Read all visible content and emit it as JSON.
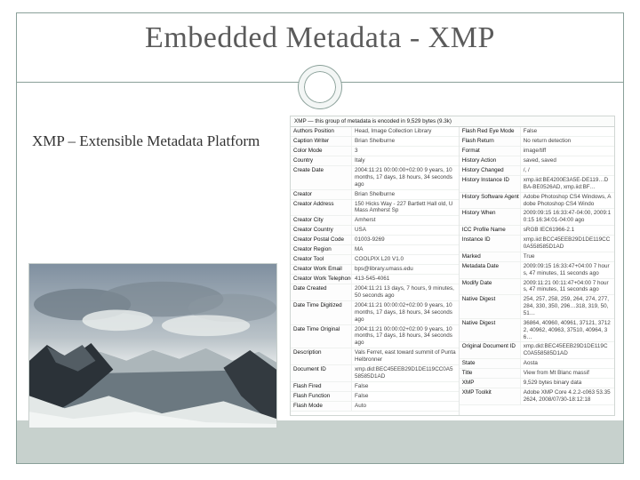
{
  "title": "Embedded Metadata - XMP",
  "subtitle": "XMP – Extensible Metadata Platform",
  "meta_header": "XMP — this group of metadata is encoded in 9,529 bytes (9.3k)",
  "left_rows": [
    {
      "k": "Authors Position",
      "v": "Head, Image Collection Library"
    },
    {
      "k": "Caption Writer",
      "v": "Brian Shelburne"
    },
    {
      "k": "Color Mode",
      "v": "3"
    },
    {
      "k": "Country",
      "v": "Italy"
    },
    {
      "k": "Create Date",
      "v": "2004:11:21 00:00:00+02:00\n9 years, 10 months, 17 days, 18 hours, 34 seconds ago"
    },
    {
      "k": "Creator",
      "v": "Brian Shelburne"
    },
    {
      "k": "Creator Address",
      "v": "150 Hicks Way - 227 Bartlett Hall old, UMass Amherst Sp"
    },
    {
      "k": "Creator City",
      "v": "Amherst"
    },
    {
      "k": "Creator Country",
      "v": "USA"
    },
    {
      "k": "Creator Postal Code",
      "v": "01003-9269"
    },
    {
      "k": "Creator Region",
      "v": "MA"
    },
    {
      "k": "Creator Tool",
      "v": "COOLPIX L20 V1.0"
    },
    {
      "k": "Creator Work Email",
      "v": "bps@library.umass.edu"
    },
    {
      "k": "Creator Work Telephone",
      "v": "413-545-4061"
    },
    {
      "k": "Date Created",
      "v": "2004:11:21\n13 days, 7 hours, 9 minutes, 50 seconds ago"
    },
    {
      "k": "Date Time Digitized",
      "v": "2004:11:21 00:00:02+02:00\n9 years, 10 months, 17 days, 18 hours, 34 seconds ago"
    },
    {
      "k": "Date Time Original",
      "v": "2004:11:21 00:00:02+02:00\n9 years, 10 months, 17 days, 18 hours, 34 seconds ago"
    },
    {
      "k": "Description",
      "v": "Vals Ferret, east toward summit of Punta Helbronner"
    },
    {
      "k": "Document ID",
      "v": "xmp.did:BEC45EEB29D1DE119CC0A558585D1AD"
    },
    {
      "k": "Flash Fired",
      "v": "False"
    },
    {
      "k": "Flash Function",
      "v": "False"
    },
    {
      "k": "Flash Mode",
      "v": "Auto"
    }
  ],
  "right_rows": [
    {
      "k": "Flash Red Eye Mode",
      "v": "False"
    },
    {
      "k": "Flash Return",
      "v": "No return detection"
    },
    {
      "k": "Format",
      "v": "image/tiff"
    },
    {
      "k": "History Action",
      "v": "saved, saved"
    },
    {
      "k": "History Changed",
      "v": "/, /"
    },
    {
      "k": "History Instance ID",
      "v": "xmp.iid:BE4200E3A5E-DE119…DBA-BE0526AD, xmp.iid:BF…"
    },
    {
      "k": "History Software Agent",
      "v": "Adobe Photoshop CS4 Windows, Adobe Photoshop CS4 Windo"
    },
    {
      "k": "History When",
      "v": "2009:09:15 16:33:47-04:00, 2009:10:15 16:34:01-04:00 ago"
    },
    {
      "k": "ICC Profile Name",
      "v": "sRGB IEC61966-2.1"
    },
    {
      "k": "Instance ID",
      "v": "xmp.iid:BCC45EEB29D1DE119CC0A558585D1AD"
    },
    {
      "k": "Marked",
      "v": "True"
    },
    {
      "k": "Metadata Date",
      "v": "2009:09:15 16:33:47+04:00\n7 hours, 47 minutes, 11 seconds ago"
    },
    {
      "k": "Modify Date",
      "v": "2009:11:21 00:11:47+04:00\n7 hours, 47 minutes, 11 seconds ago"
    },
    {
      "k": "Native Digest",
      "v": "254, 257, 258, 259, 264, 274, 277, 284, 330, 350, 296…318, 319, 50, 51…"
    },
    {
      "k": "Native Digest",
      "v": "36864, 40960, 40961, 37121, 37122, 40962, 40963, 37510, 40964, 36…"
    },
    {
      "k": "Original Document ID",
      "v": "xmp.did:BEC45EEB29D1DE119CC0A558585D1AD"
    },
    {
      "k": "State",
      "v": "Aosta"
    },
    {
      "k": "Title",
      "v": "View from Mt Blanc massif"
    },
    {
      "k": "XMP",
      "v": "9,529 bytes binary data"
    },
    {
      "k": "XMP Toolkit",
      "v": "Adobe XMP Core 4.2.2-c063 53.352624, 2008/07/30-18:12:18"
    }
  ]
}
